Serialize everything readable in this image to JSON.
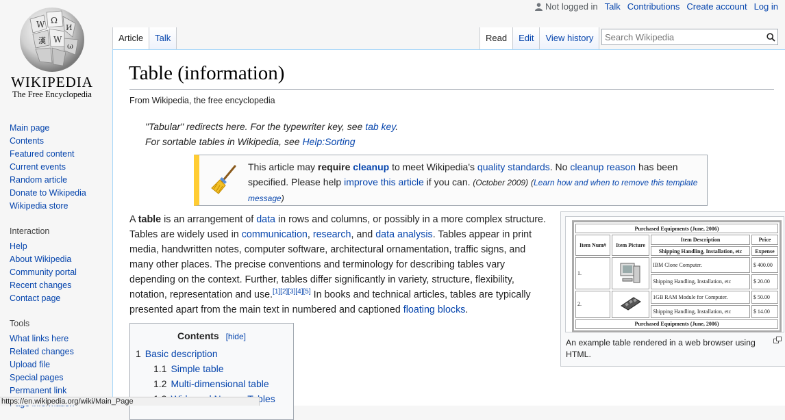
{
  "personal": {
    "user_status": "Not logged in",
    "talk": "Talk",
    "contributions": "Contributions",
    "create_account": "Create account",
    "login": "Log in"
  },
  "logo": {
    "wordmark": "WIKIPEDIA",
    "tagline": "The Free Encyclopedia"
  },
  "nav": {
    "main": [
      "Main page",
      "Contents",
      "Featured content",
      "Current events",
      "Random article",
      "Donate to Wikipedia",
      "Wikipedia store"
    ],
    "interaction_heading": "Interaction",
    "interaction": [
      "Help",
      "About Wikipedia",
      "Community portal",
      "Recent changes",
      "Contact page"
    ],
    "tools_heading": "Tools",
    "tools": [
      "What links here",
      "Related changes",
      "Upload file",
      "Special pages",
      "Permanent link",
      "Page information"
    ]
  },
  "tabs": {
    "left": [
      "Article",
      "Talk"
    ],
    "right": [
      "Read",
      "Edit",
      "View history"
    ]
  },
  "search": {
    "placeholder": "Search Wikipedia"
  },
  "article": {
    "title": "Table (information)",
    "site_sub": "From Wikipedia, the free encyclopedia",
    "hatnote1_pre": "\"Tabular\" redirects here. For the typewriter key, see ",
    "hatnote1_link": "tab key",
    "hatnote1_post": ".",
    "hatnote2_pre": "For sortable tables in Wikipedia, see ",
    "hatnote2_link": "Help:Sorting",
    "ambox": {
      "t1": "This article may ",
      "t2": "require",
      "t3": "cleanup",
      "t4": " to meet Wikipedia's ",
      "t5": "quality standards",
      "t6": ". No ",
      "t7": "cleanup reason",
      "t8": " has been specified. Please help ",
      "t9": "improve this article",
      "t10": " if you can. ",
      "date": "(October 2009)",
      "learn_pre": "(",
      "learn": "Learn how and when to remove this template message",
      "learn_post": ")"
    },
    "intro": {
      "a": "A ",
      "table": "table",
      "b": " is an arrangement of ",
      "data": "data",
      "c": " in rows and columns, or possibly in a more complex structure. Tables are widely used in ",
      "communication": "communication",
      "d": ", ",
      "research": "research",
      "e": ", and ",
      "data_analysis": "data analysis",
      "f": ". Tables appear in print media, handwritten notes, computer software, architectural ornamentation, traffic signs, and many other places. The precise conventions and terminology for describing tables vary depending on the context. Further, tables differ significantly in variety, structure, flexibility, notation, representation and use.",
      "refs": "[1][2][3][4][5]",
      "g": " In books and technical articles, tables are typically presented apart from the main text in numbered and captioned ",
      "floating_blocks": "floating blocks",
      "h": "."
    },
    "thumb": {
      "caption": "An example table rendered in a web browser using HTML.",
      "table_title": "Purchased Equipments (June, 2006)",
      "h_item_num": "Item Num#",
      "h_item_picture": "Item Picture",
      "h_item_desc": "Item Description",
      "h_price": "Price",
      "sh_desc": "Shipping Handling, Installation, etc",
      "sh_price": "Expense",
      "rows": [
        {
          "num": "1.",
          "desc1": "IBM Clone Computer.",
          "price1": "$ 400.00",
          "desc2": "Shipping Handling, Installation, etc",
          "price2": "$ 20.00"
        },
        {
          "num": "2.",
          "desc1": "1GB RAM Module for Computer.",
          "price1": "$ 50.00",
          "desc2": "Shipping Handling, Installation, etc",
          "price2": "$ 14.00"
        }
      ],
      "footer": "Purchased Equipments (June, 2006)"
    },
    "toc": {
      "title": "Contents",
      "hide": "[hide]",
      "items": [
        {
          "num": "1",
          "label": "Basic description"
        },
        {
          "num": "1.1",
          "label": "Simple table"
        },
        {
          "num": "1.2",
          "label": "Multi-dimensional table"
        },
        {
          "num": "1.3",
          "label": "Wide and Narrow Tables"
        }
      ]
    }
  },
  "status_bar": "https://en.wikipedia.org/wiki/Main_Page"
}
